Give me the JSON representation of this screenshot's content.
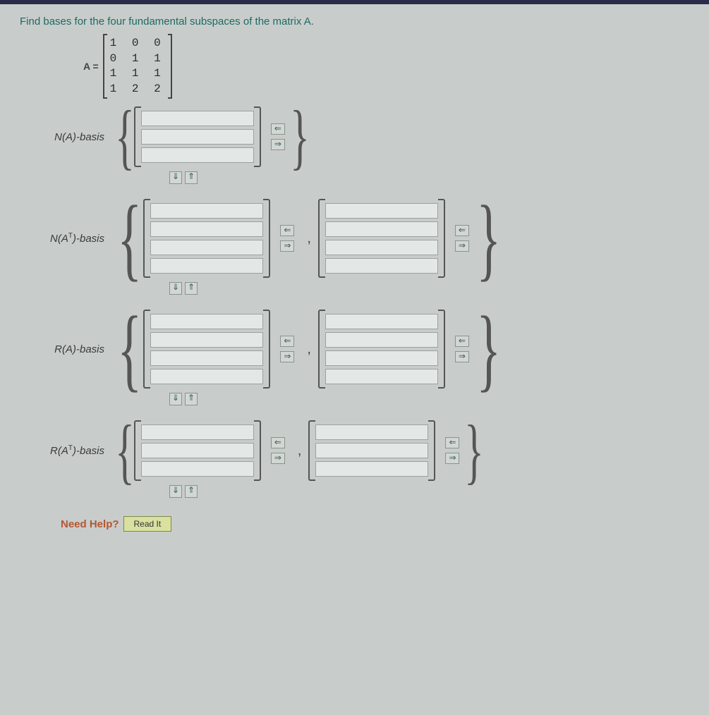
{
  "prompt": "Find bases for the four fundamental subspaces of the matrix A.",
  "matrix_label": "A =",
  "matrix_rows": [
    "1 0 0",
    "0 1 1",
    "1 1 1",
    "1 2 2"
  ],
  "sections": [
    {
      "label_plain": "N(A)-basis",
      "label_html": "N(A)-basis",
      "vectors": 1,
      "rows": 3
    },
    {
      "label_plain": "N(AT)-basis",
      "label_html": "N(A<sup>T</sup>)-basis",
      "vectors": 2,
      "rows": 4
    },
    {
      "label_plain": "R(A)-basis",
      "label_html": "R(A)-basis",
      "vectors": 2,
      "rows": 4
    },
    {
      "label_plain": "R(AT)-basis",
      "label_html": "R(A<sup>T</sup>)-basis",
      "vectors": 2,
      "rows": 3
    }
  ],
  "arrows": {
    "left": "⇐",
    "right": "⇒",
    "up": "⇑",
    "down": "⇓"
  },
  "need_help": {
    "label": "Need Help?",
    "read_it": "Read It"
  }
}
